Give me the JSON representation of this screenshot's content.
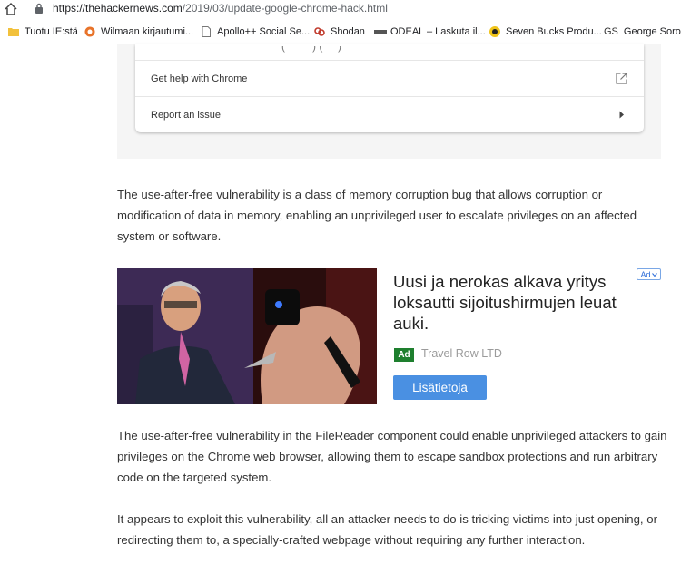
{
  "browser": {
    "url_host": "https://thehackernews.com",
    "url_path": "/2019/03/update-google-chrome-hack.html"
  },
  "bookmarks": [
    {
      "label": "Tuotu IE:stä",
      "icon": "folder-icon",
      "color": "#f2c13c"
    },
    {
      "label": "Wilmaan kirjautumi...",
      "icon": "site-icon",
      "color": "#e8732a"
    },
    {
      "label": "Apollo++ Social Se...",
      "icon": "page-icon",
      "color": "#9aa0a6"
    },
    {
      "label": "Shodan",
      "icon": "shodan-icon",
      "color": "#c0392b"
    },
    {
      "label": "ODEAL – Laskuta il...",
      "icon": "odeal-icon",
      "color": "#555555"
    },
    {
      "label": "Seven Bucks Produ...",
      "icon": "sevenbucks-icon",
      "color": "#f0c419"
    },
    {
      "label": "George Soros",
      "prefix": "GS",
      "icon": "gs-icon",
      "color": "#333333"
    }
  ],
  "help_card": {
    "items": [
      {
        "label": "Get help with Chrome",
        "icon": "external-link-icon"
      },
      {
        "label": "Report an issue",
        "icon": "caret-right-icon"
      }
    ]
  },
  "article": {
    "para1": [
      "The use-after-free vulnerability is a class of memory corruption bug that allows corruption or",
      "modification of data in memory, enabling an unprivileged user to escalate privileges on an affected",
      "system or software."
    ],
    "para2": [
      "The use-after-free vulnerability in the FileReader component could enable unprivileged attackers to gain",
      "privileges on the Chrome web browser, allowing them to escape sandbox protections and run arbitrary",
      "code on the targeted system."
    ],
    "para3": [
      "It appears to exploit this vulnerability, all an attacker needs to do is tricking victims into just opening, or",
      "redirecting them to, a specially-crafted webpage without requiring any further interaction."
    ]
  },
  "ad": {
    "choice_label": "Ad",
    "headline": [
      "Uusi ja nerokas alkava yritys",
      "loksautti sijoitushirmujen leuat",
      "auki."
    ],
    "badge": "Ad",
    "advertiser": "Travel Row LTD",
    "cta": "Lisätietoja"
  },
  "colors": {
    "accent": "#4a90e2",
    "ad_badge": "#1e7f2e"
  }
}
